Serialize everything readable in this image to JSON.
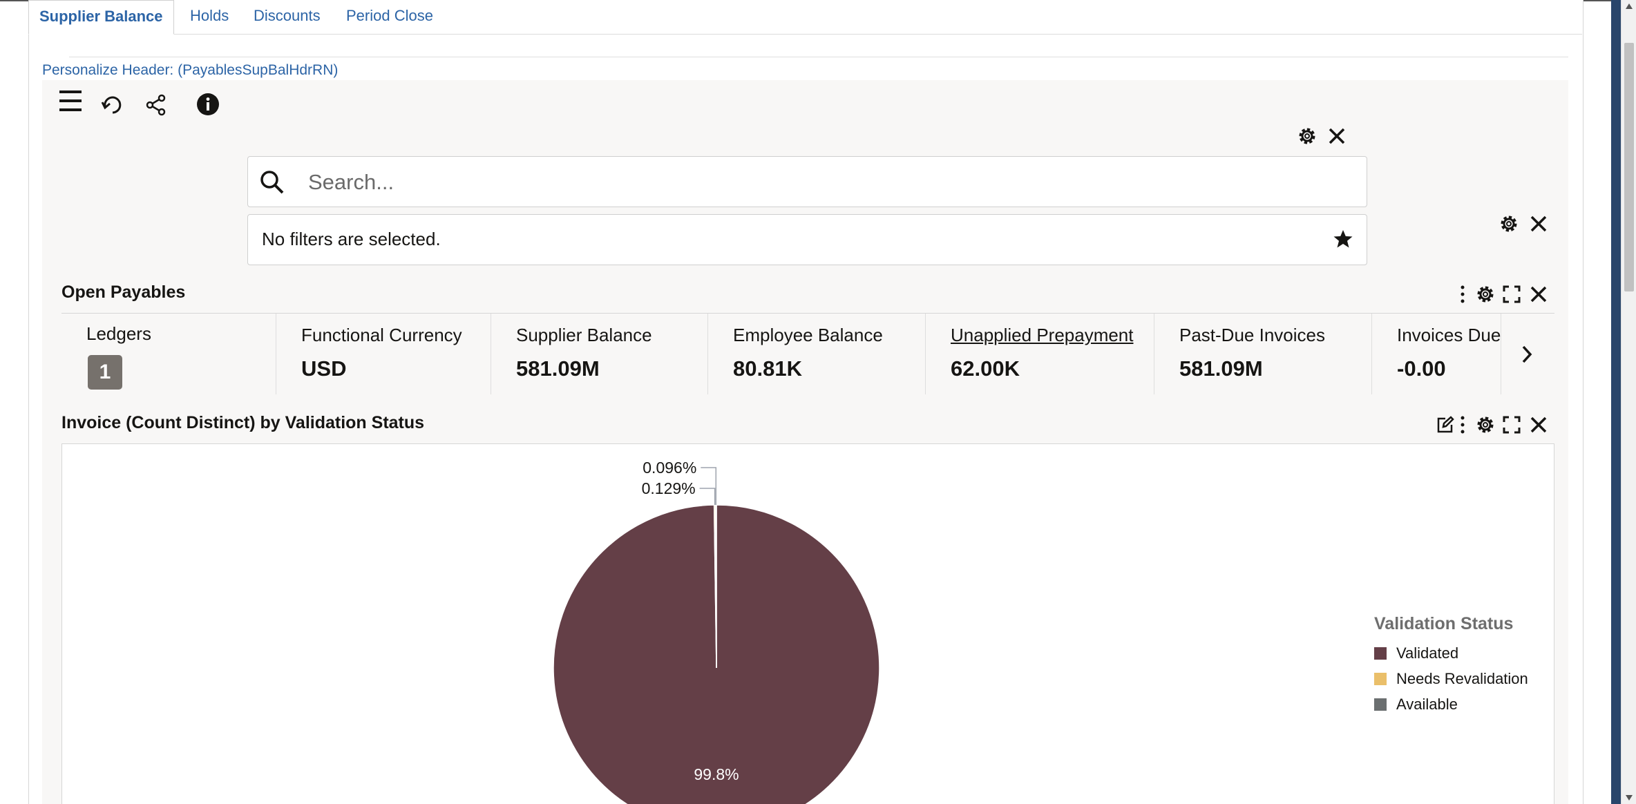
{
  "tabs": [
    {
      "label": "Supplier Balance",
      "active": true
    },
    {
      "label": "Holds",
      "active": false
    },
    {
      "label": "Discounts",
      "active": false
    },
    {
      "label": "Period Close",
      "active": false
    }
  ],
  "personalize_link": "Personalize Header: (PayablesSupBalHdrRN)",
  "toolbar": {
    "icons": [
      "menu-icon",
      "undo-icon",
      "share-icon",
      "info-icon"
    ]
  },
  "search": {
    "placeholder": "Search...",
    "value": ""
  },
  "filters": {
    "text": "No filters are selected."
  },
  "open_payables": {
    "title": "Open Payables",
    "kpis": [
      {
        "label": "Ledgers",
        "value": "1",
        "style": "badge"
      },
      {
        "label": "Functional Currency",
        "value": "USD"
      },
      {
        "label": "Supplier Balance",
        "value": "581.09M"
      },
      {
        "label": "Employee Balance",
        "value": "80.81K"
      },
      {
        "label": "Unapplied Prepayment",
        "value": "62.00K",
        "link": true
      },
      {
        "label": "Past-Due Invoices",
        "value": "581.09M"
      },
      {
        "label": "Invoices Due",
        "value": "-0.00"
      }
    ]
  },
  "chart_section": {
    "title": "Invoice (Count Distinct) by Validation Status"
  },
  "chart_data": {
    "type": "pie",
    "title": "Invoice (Count Distinct) by Validation Status",
    "legend_title": "Validation Status",
    "legend_position": "right",
    "slices": [
      {
        "name": "Validated",
        "value": 99.8,
        "label": "99.8%",
        "color": "#643f47"
      },
      {
        "name": "Needs Revalidation",
        "value": 0.129,
        "label": "0.129%",
        "color": "#eabf6a"
      },
      {
        "name": "Available",
        "value": 0.096,
        "label": "0.096%",
        "color": "#6b6f70"
      }
    ]
  },
  "colors": {
    "link": "#2c64a6",
    "region_bg": "#f8f7f6",
    "badge": "#76716c"
  }
}
